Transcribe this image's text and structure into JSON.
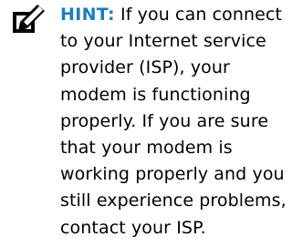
{
  "hint": {
    "icon": "pencil-note-icon",
    "label": "HINT:",
    "label_color": "#1b7cc1",
    "lines": [
      " If you can connect",
      "to your Internet service",
      "provider (ISP), your",
      "modem is functioning",
      "properly. If you are sure",
      "that your modem is",
      "working properly and you",
      "still experience problems,",
      "contact your ISP."
    ]
  }
}
